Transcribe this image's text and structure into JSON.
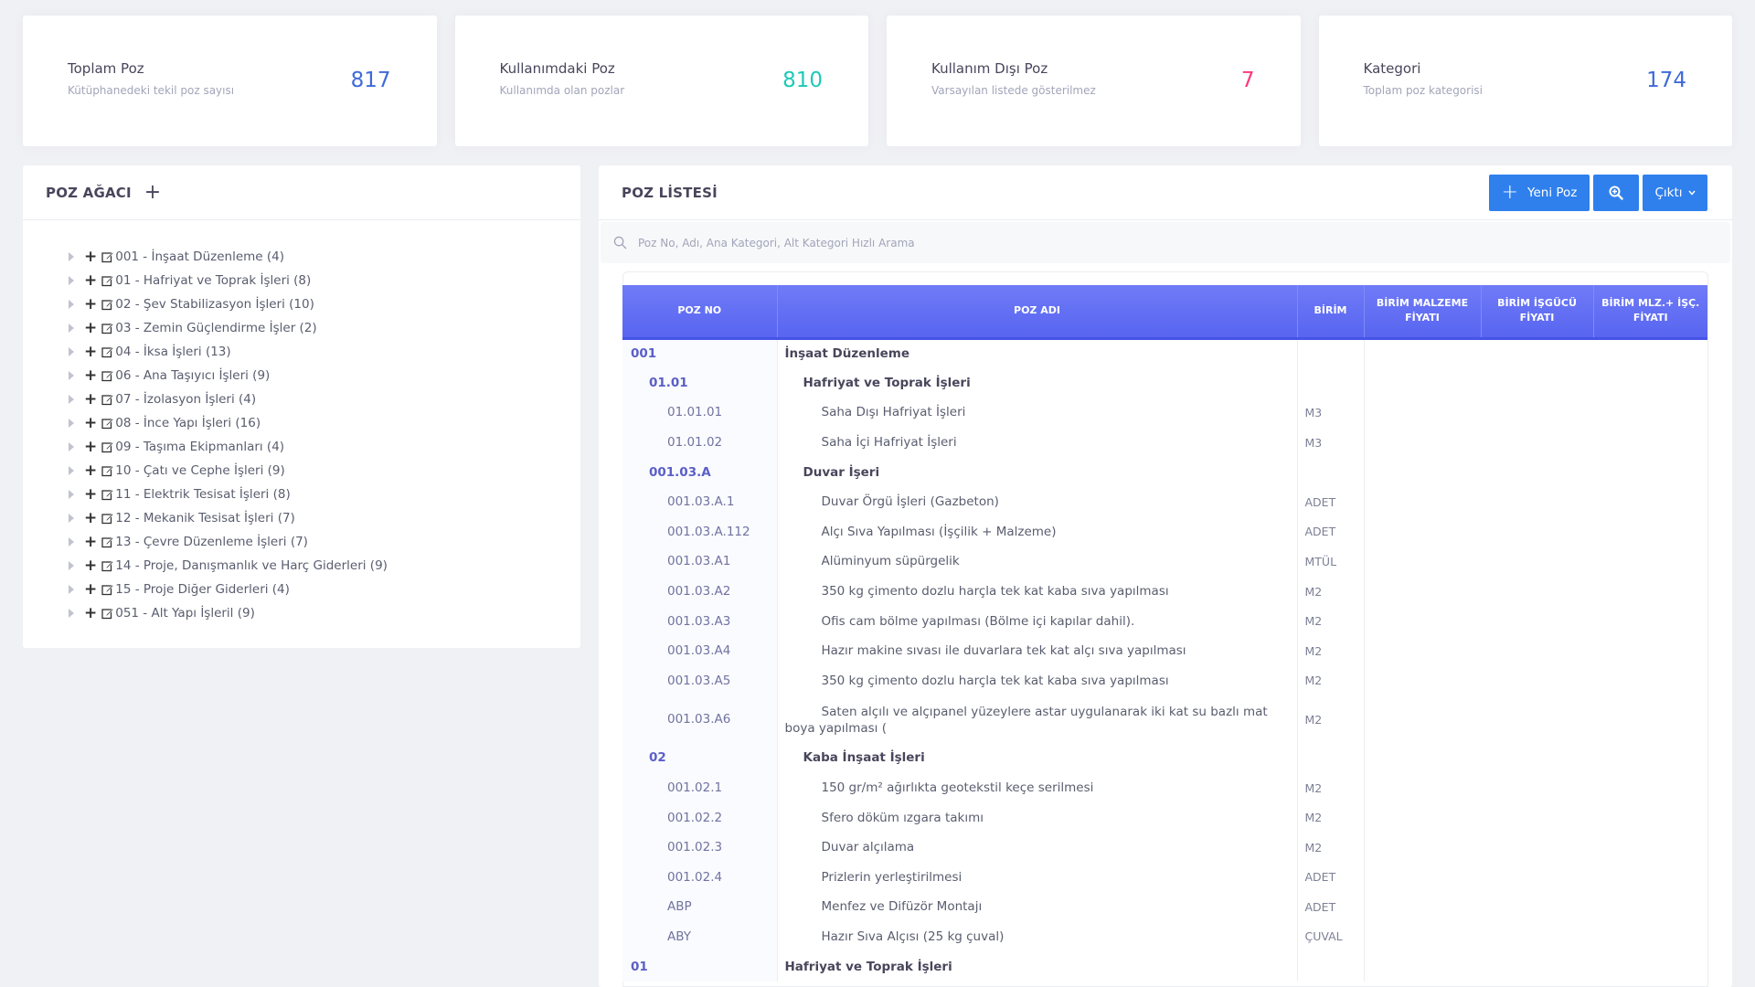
{
  "stats": [
    {
      "title": "Toplam Poz",
      "subtitle": "Kütüphanedeki tekil poz sayısı",
      "value": "817",
      "color": "#3f6ad8"
    },
    {
      "title": "Kullanımdaki Poz",
      "subtitle": "Kullanımda olan pozlar",
      "value": "810",
      "color": "#1dc9b7"
    },
    {
      "title": "Kullanım Dışı Poz",
      "subtitle": "Varsayılan listede gösterilmez",
      "value": "7",
      "color": "#fd397a"
    },
    {
      "title": "Kategori",
      "subtitle": "Toplam poz kategorisi",
      "value": "174",
      "color": "#3f6ad8"
    }
  ],
  "tree": {
    "title": "POZ AĞACI",
    "items": [
      "001 - İnşaat Düzenleme (4)",
      "01 - Hafriyat ve Toprak İşleri (8)",
      "02 - Şev Stabilizasyon İşleri (10)",
      "03 - Zemin Güçlendirme İşler (2)",
      "04 - İksa İşleri (13)",
      "06 - Ana Taşıyıcı İşleri (9)",
      "07 - İzolasyon İşleri (4)",
      "08 - İnce Yapı İşleri (16)",
      "09 - Taşıma Ekipmanları (4)",
      "10 - Çatı ve Cephe İşleri (9)",
      "11 - Elektrik Tesisat İşleri (8)",
      "12 - Mekanik Tesisat İşleri (7)",
      "13 - Çevre Düzenleme İşleri (7)",
      "14 - Proje, Danışmanlık ve Harç Giderleri (9)",
      "15 - Proje Diğer Giderleri (4)",
      "051 - Alt Yapı İşleril (9)"
    ]
  },
  "list": {
    "title": "POZ LİSTESİ",
    "new_button": "Yeni Poz",
    "output_button": "Çıktı",
    "search_placeholder": "Poz No, Adı, Ana Kategori, Alt Kategori Hızlı Arama",
    "columns": [
      "POZ NO",
      "POZ ADI",
      "BİRİM",
      "BİRİM MALZEME FİYATI",
      "BİRİM İŞGÜCÜ FİYATI",
      "BİRİM MLZ.+ İŞÇ. FİYATI"
    ],
    "rows": [
      {
        "level": 0,
        "no": "001",
        "name": "İnşaat Düzenleme",
        "unit": ""
      },
      {
        "level": 1,
        "no": "01.01",
        "name": "Hafriyat ve Toprak İşleri",
        "unit": ""
      },
      {
        "level": 2,
        "no": "01.01.01",
        "name": "Saha Dışı Hafriyat İşleri",
        "unit": "M3"
      },
      {
        "level": 2,
        "no": "01.01.02",
        "name": "Saha İçi Hafriyat İşleri",
        "unit": "M3"
      },
      {
        "level": 1,
        "no": "001.03.A",
        "name": "Duvar İşeri",
        "unit": ""
      },
      {
        "level": 2,
        "no": "001.03.A.1",
        "name": "Duvar Örgü İşleri (Gazbeton)",
        "unit": "ADET"
      },
      {
        "level": 2,
        "no": "001.03.A.112",
        "name": "Alçı Sıva Yapılması (İşçilik + Malzeme)",
        "unit": "ADET"
      },
      {
        "level": 2,
        "no": "001.03.A1",
        "name": "Alüminyum süpürgelik",
        "unit": "MTÜL"
      },
      {
        "level": 2,
        "no": "001.03.A2",
        "name": "350 kg çimento dozlu harçla tek kat kaba sıva yapılması",
        "unit": "M2"
      },
      {
        "level": 2,
        "no": "001.03.A3",
        "name": "Ofis cam bölme yapılması (Bölme içi kapılar dahil).",
        "unit": "M2"
      },
      {
        "level": 2,
        "no": "001.03.A4",
        "name": "Hazır makine sıvası ile duvarlara tek kat alçı sıva yapılması",
        "unit": "M2"
      },
      {
        "level": 2,
        "no": "001.03.A5",
        "name": "350 kg çimento dozlu harçla tek kat kaba sıva yapılması",
        "unit": "M2"
      },
      {
        "level": 2,
        "no": "001.03.A6",
        "name": "Saten alçılı ve alçıpanel yüzeylere astar uygulanarak iki kat su bazlı mat boya yapılması (",
        "unit": "M2",
        "tall": true
      },
      {
        "level": 1,
        "no": "02",
        "name": "Kaba İnşaat İşleri",
        "unit": ""
      },
      {
        "level": 2,
        "no": "001.02.1",
        "name": "150 gr/m² ağırlıkta geotekstil keçe serilmesi",
        "unit": "M2"
      },
      {
        "level": 2,
        "no": "001.02.2",
        "name": "Sfero döküm ızgara takımı",
        "unit": "M2"
      },
      {
        "level": 2,
        "no": "001.02.3",
        "name": "Duvar alçılama",
        "unit": "M2"
      },
      {
        "level": 2,
        "no": "001.02.4",
        "name": "Prizlerin yerleştirilmesi",
        "unit": "ADET"
      },
      {
        "level": 2,
        "no": "ABP",
        "name": "Menfez ve Difüzör Montajı",
        "unit": "ADET"
      },
      {
        "level": 2,
        "no": "ABY",
        "name": "Hazır Sıva Alçısı (25 kg çuval)",
        "unit": "ÇUVAL"
      },
      {
        "level": 0,
        "no": "01",
        "name": "Hafriyat ve Toprak İşleri",
        "unit": ""
      }
    ]
  }
}
